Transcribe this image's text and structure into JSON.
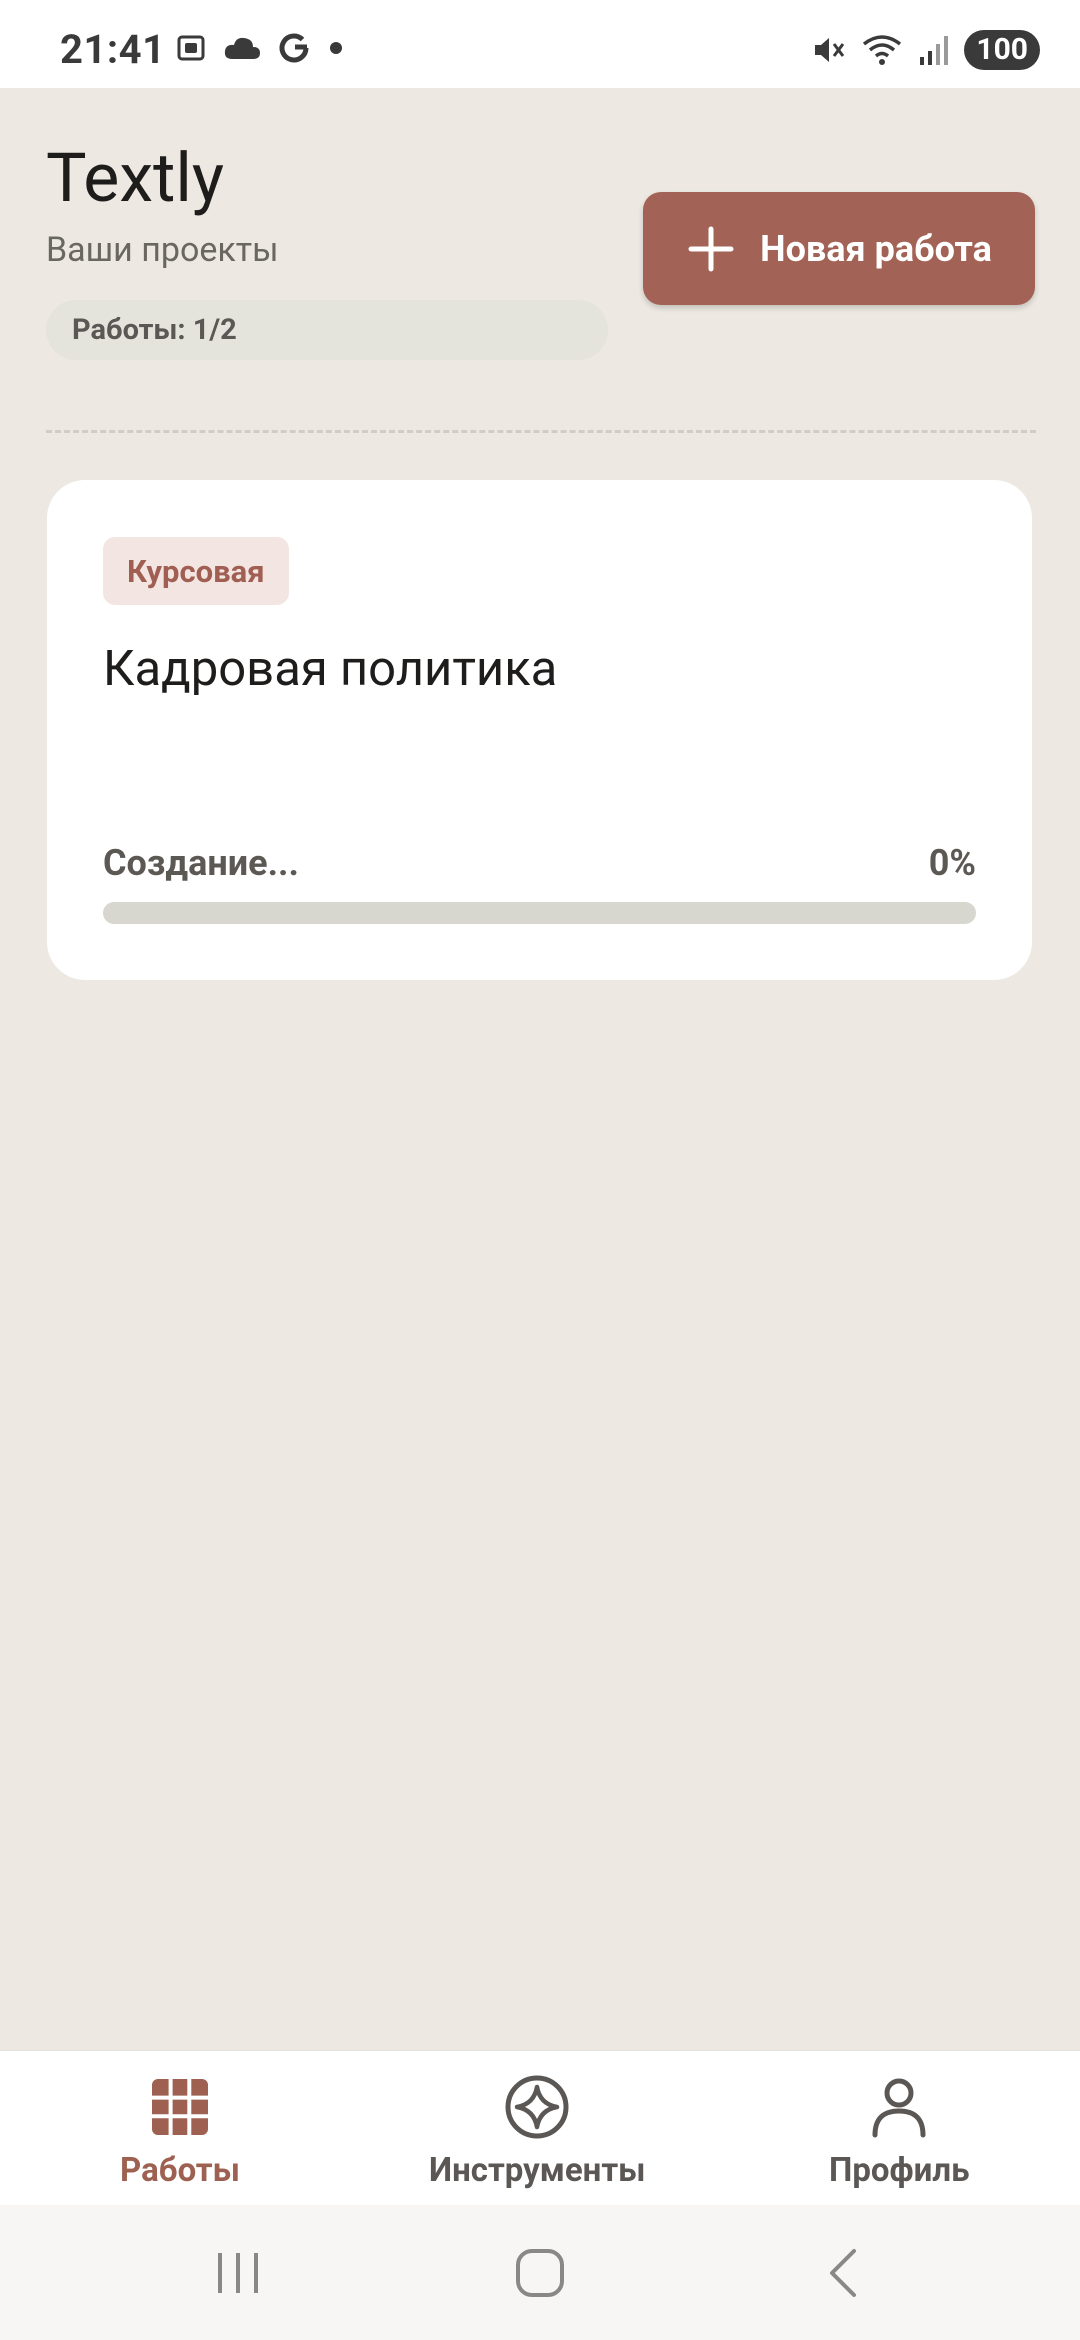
{
  "status_bar": {
    "time": "21:41",
    "left_icons": [
      "screenshot-icon",
      "cloud-icon",
      "google-icon",
      "dot-icon"
    ],
    "right_icons": [
      "mute-icon",
      "wifi-icon",
      "signal-icon"
    ],
    "battery": "100"
  },
  "header": {
    "title": "Textly",
    "subtitle": "Ваши проекты",
    "count_label": "Работы: 1/2",
    "new_button_label": "Новая работа"
  },
  "colors": {
    "accent": "#a36256",
    "background": "#ede9e2",
    "card": "#ffffff"
  },
  "works": [
    {
      "tag": "Курсовая",
      "title": "Кадровая политика",
      "status": "Создание...",
      "progress_text": "0%",
      "progress": 0
    }
  ],
  "bottom_nav": {
    "items": [
      {
        "label": "Работы",
        "icon": "grid-icon",
        "active": true
      },
      {
        "label": "Инструменты",
        "icon": "sparkle-icon",
        "active": false
      },
      {
        "label": "Профиль",
        "icon": "person-icon",
        "active": false
      }
    ]
  },
  "system_nav": [
    "recents-icon",
    "home-icon",
    "back-icon"
  ]
}
